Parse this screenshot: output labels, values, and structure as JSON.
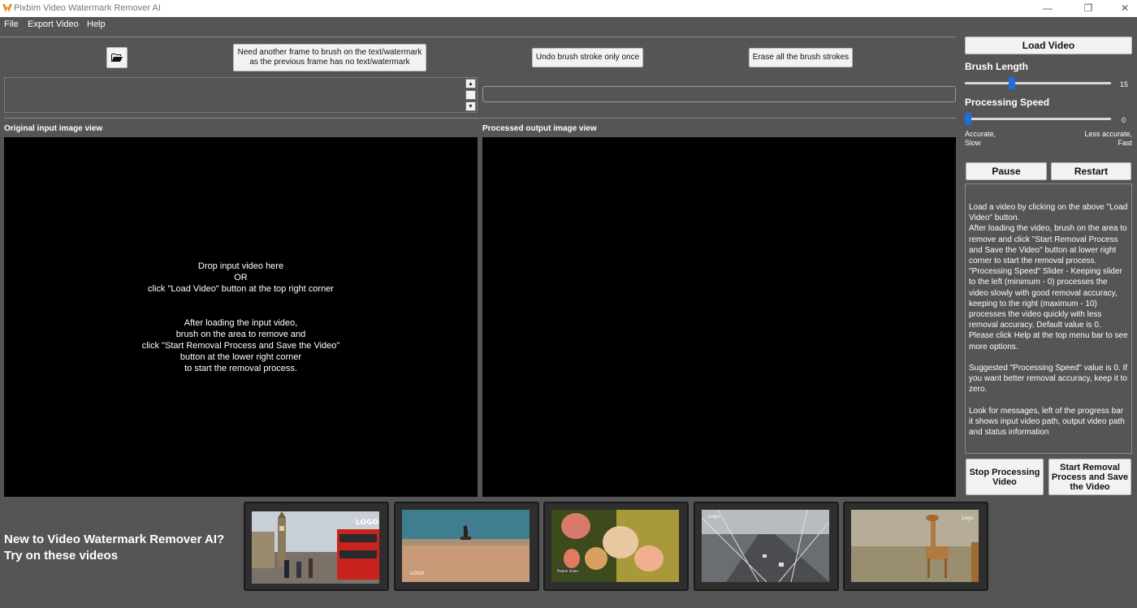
{
  "window": {
    "title": "Pixbim Video Watermark Remover AI",
    "controls": {
      "minimize": "—",
      "restore": "❐",
      "close": "✕"
    }
  },
  "menu": {
    "items": [
      "File",
      "Export Video",
      "Help"
    ]
  },
  "toolbar": {
    "folder_icon": "folder-open-icon",
    "another_frame_line1": "Need another frame to brush on the text/watermark",
    "another_frame_line2": "as the previous frame has no text/watermark",
    "undo_label": "Undo brush stroke only once",
    "erase_label": "Erase all the brush strokes"
  },
  "views": {
    "input_label": "Original input image view",
    "output_label": "Processed output image view",
    "drop_lines_1": [
      "Drop input video here",
      "OR",
      "click \"Load Video\" button at the top right corner"
    ],
    "drop_lines_2": [
      "After loading the input video,",
      "brush on the area to remove and",
      "click \"Start Removal Process and Save the Video\"",
      "button at the lower right corner",
      "to start the removal process."
    ]
  },
  "right_panel": {
    "load_video": "Load Video",
    "brush_length_label": "Brush Length",
    "brush_length_value": "15",
    "brush_length_level": 15,
    "brush_length_max": 50,
    "speed_label": "Processing Speed",
    "speed_value": "0",
    "speed_level": 0,
    "speed_left_1": "Accurate,",
    "speed_left_2": "Slow",
    "speed_right_1": "Less accurate,",
    "speed_right_2": "Fast",
    "pause": "Pause",
    "restart": "Restart",
    "help_text": "Load a video by clicking on the above \"Load Video\" button.\nAfter loading the video, brush on the area to remove and click \"Start Removal Process and Save the Video\" button at lower right corner to start the removal process.\n\"Processing Speed\" Slider - Keeping slider to the left (minimum - 0) processes the video slowly with good removal accuracy, keeping to the right (maximum - 10) processes the video quickly with less removal accuracy, Default value is 0.\nPlease click Help at the top menu bar to see more options.\n\nSuggested \"Processing Speed\" value is 0. If you want better removal accuracy, keep it to zero.\n\nLook for messages, left of the progress bar it shows input video path, output video path and status information",
    "stop_line1": "Stop Processing",
    "stop_line2": "Video",
    "start_line1": "Start Removal",
    "start_line2": "Process and Save",
    "start_line3": "the Video"
  },
  "samples": {
    "prompt_line1": "New to Video Watermark Remover AI?",
    "prompt_line2": "Try on these videos",
    "thumbnails": [
      {
        "name": "london-big-ben-bus",
        "watermark": "LOGO"
      },
      {
        "name": "desert-rider",
        "watermark": "LOGO"
      },
      {
        "name": "tulip-flowers",
        "watermark": "Pixbim Video"
      },
      {
        "name": "bridge-traffic",
        "watermark": "Logo"
      },
      {
        "name": "giraffe-savanna",
        "watermark": "Logo"
      }
    ]
  },
  "colors": {
    "background": "#555555",
    "slider_thumb": "#1e6fd9",
    "view_bg": "#000000"
  }
}
